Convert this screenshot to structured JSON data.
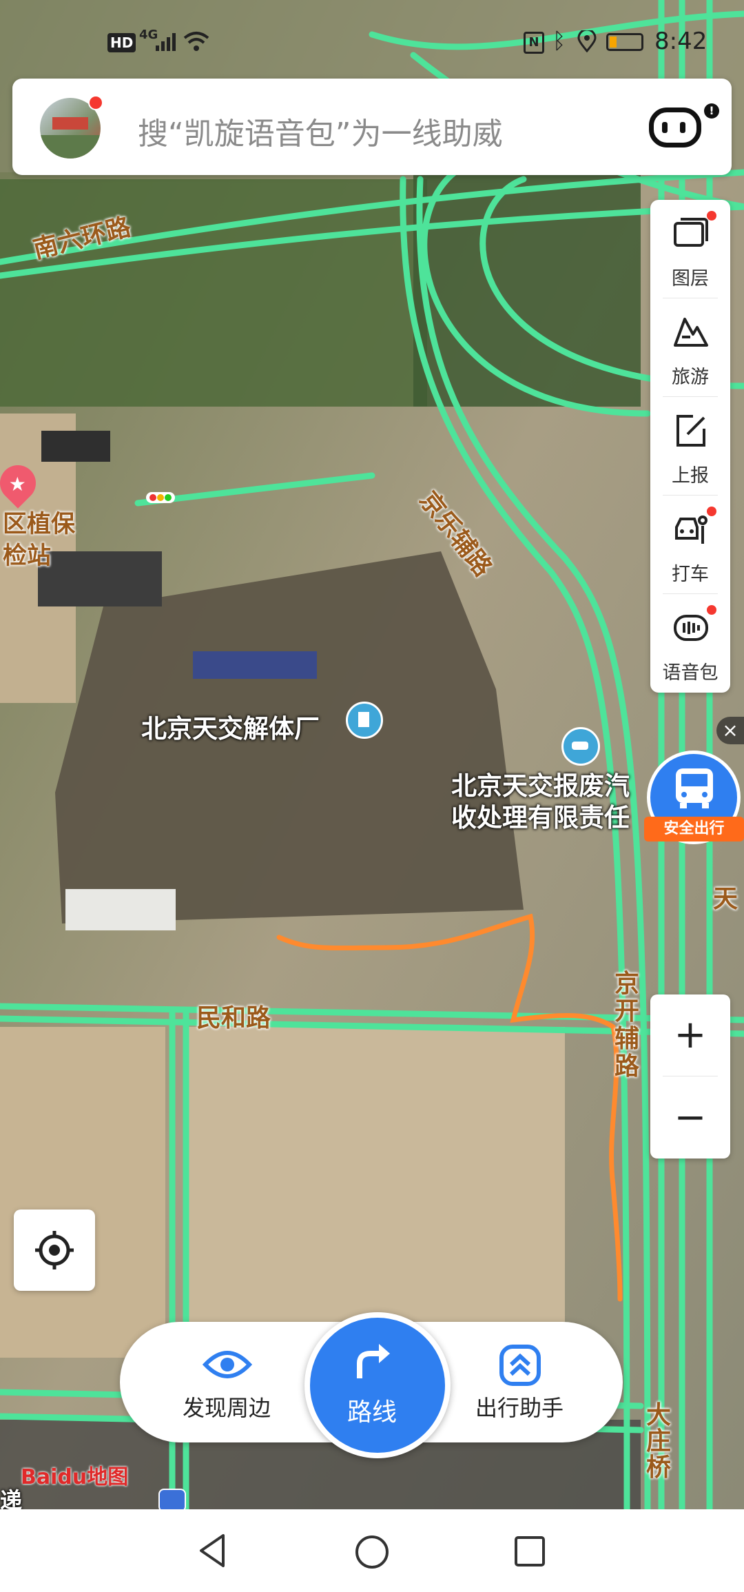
{
  "status_bar": {
    "network_type": "4G",
    "hd_badge": "HD",
    "time": "8:42",
    "icons": [
      "hd-icon",
      "signal-icon",
      "wifi-icon",
      "nfc-icon",
      "bluetooth-icon",
      "location-icon",
      "battery-icon"
    ]
  },
  "search": {
    "placeholder": "搜“凯旋语音包”为一线助威"
  },
  "side_tools": [
    {
      "label": "图层",
      "icon": "layers-icon",
      "has_badge": true
    },
    {
      "label": "旅游",
      "icon": "travel-icon",
      "has_badge": false
    },
    {
      "label": "上报",
      "icon": "report-icon",
      "has_badge": false
    },
    {
      "label": "打车",
      "icon": "taxi-icon",
      "has_badge": true
    },
    {
      "label": "语音包",
      "icon": "voice-pack-icon",
      "has_badge": true
    }
  ],
  "map": {
    "roads": {
      "south_sixth_ring": "南六环路",
      "jingle_side": "京乐辅路",
      "minhe": "民和路",
      "jingkai_side": "京开辅路",
      "dazhuang_bridge": "大庄桥"
    },
    "pois": {
      "plant_station": "区植保检站",
      "dismantling_plant": "北京天交解体厂",
      "scrap_company": "北京天交报废汽收处理有限责任"
    },
    "edge_text": {
      "right_1": "天",
      "left_bottom": "递"
    }
  },
  "safe_travel": {
    "label": "安全出行"
  },
  "zoom": {
    "in_label": "+",
    "out_label": "−"
  },
  "bottom_bar": {
    "discover_label": "发现周边",
    "route_label": "路线",
    "assistant_label": "出行助手"
  },
  "logo": {
    "text": "Baidu地图"
  },
  "colors": {
    "accent": "#2f7ff0",
    "road_green": "#4ee39a",
    "track_orange": "#ff8a2e",
    "road_label_brown": "#9b5a1b",
    "badge_red": "#f5382f",
    "safe_travel_orange": "#ff6a1a"
  }
}
